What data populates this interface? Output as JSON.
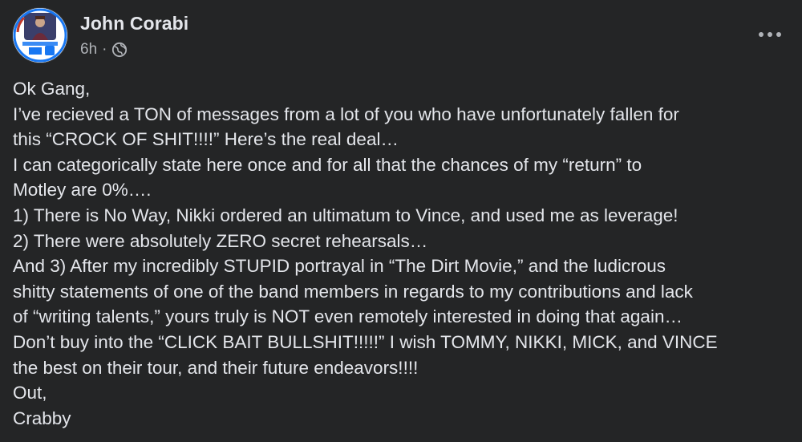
{
  "post": {
    "author": "John Corabi",
    "time": "6h",
    "separator": "·",
    "privacy_icon": "globe-icon",
    "more_icon": "more-dots-icon",
    "lines": [
      "Ok Gang,",
      "I’ve recieved a TON of messages from a lot of you who have unfortunately fallen for",
      "this “CROCK OF SHIT!!!!” Here’s the real deal…",
      "I can categorically state here once and for all that the chances of my “return” to",
      "Motley are 0%….",
      "1) There is No Way, Nikki ordered an ultimatum to Vince, and used me as leverage!",
      "2) There were absolutely ZERO secret rehearsals…",
      "And 3) After my incredibly STUPID portrayal in “The Dirt Movie,” and the ludicrous",
      "shitty statements of one of the band members in regards to my contributions and lack",
      "of “writing talents,”  yours truly is NOT even remotely interested in doing that again…",
      "Don’t buy into the “CLICK BAIT BULLSHIT!!!!!” I wish TOMMY, NIKKI, MICK, and VINCE",
      "the best on their tour, and their future endeavors!!!!",
      "Out,",
      "Crabby"
    ]
  },
  "colors": {
    "background": "#242526",
    "primary_text": "#e4e6eb",
    "secondary_text": "#b0b3b8",
    "avatar_accent": "#1877f2"
  }
}
